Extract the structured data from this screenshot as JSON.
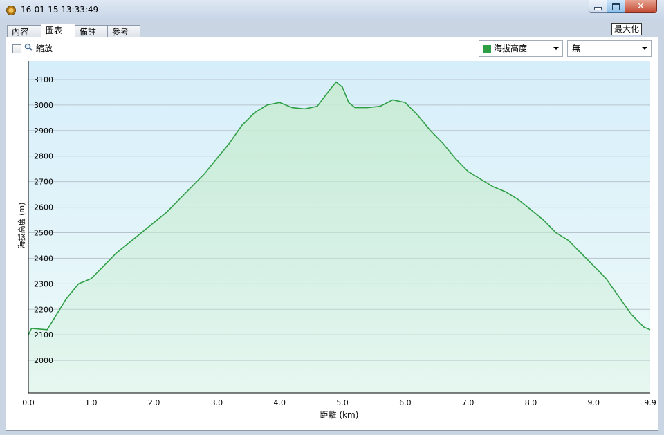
{
  "window": {
    "title": "16-01-15 13:33:49",
    "tooltip": "最大化"
  },
  "tabs": [
    "內容",
    "圖表",
    "備註",
    "參考"
  ],
  "active_tab": 1,
  "toolbar": {
    "zoom_label": "縮放",
    "zoom_checked": false,
    "series_select": "海拔高度",
    "compare_select": "無"
  },
  "colors": {
    "line": "#2e9e45",
    "plot_top": "#d6eefa",
    "plot_bottom": "#eefaf8",
    "fill": "#c8ecd2"
  },
  "chart_data": {
    "type": "area",
    "xlabel": "距離  (km)",
    "ylabel": "海拔高度 (m)",
    "x_ticks": [
      "0.0",
      "1.0",
      "2.0",
      "3.0",
      "4.0",
      "5.0",
      "6.0",
      "7.0",
      "8.0",
      "9.0",
      "9.9"
    ],
    "y_ticks": [
      "2000",
      "2100",
      "2200",
      "2300",
      "2400",
      "2500",
      "2600",
      "2700",
      "2800",
      "2900",
      "3000",
      "3100"
    ],
    "xlim": [
      0,
      9.9
    ],
    "ylim": [
      1873,
      3173
    ],
    "grid": true,
    "series": [
      {
        "x": [
          0.0,
          0.05,
          0.3,
          0.5,
          0.6,
          0.8,
          1.0,
          1.2,
          1.4,
          1.6,
          1.8,
          2.0,
          2.2,
          2.4,
          2.6,
          2.8,
          3.0,
          3.2,
          3.4,
          3.6,
          3.8,
          4.0,
          4.2,
          4.4,
          4.6,
          4.8,
          4.9,
          5.0,
          5.1,
          5.2,
          5.4,
          5.6,
          5.8,
          6.0,
          6.2,
          6.4,
          6.6,
          6.8,
          7.0,
          7.2,
          7.4,
          7.6,
          7.8,
          8.0,
          8.2,
          8.4,
          8.6,
          8.8,
          9.0,
          9.2,
          9.4,
          9.6,
          9.8,
          9.9
        ],
        "y": [
          2100,
          2125,
          2120,
          2200,
          2240,
          2300,
          2320,
          2370,
          2420,
          2460,
          2500,
          2540,
          2580,
          2630,
          2680,
          2730,
          2790,
          2850,
          2920,
          2970,
          3000,
          3010,
          2990,
          2985,
          2995,
          3060,
          3090,
          3070,
          3010,
          2990,
          2990,
          2995,
          3020,
          3010,
          2960,
          2900,
          2850,
          2790,
          2740,
          2710,
          2680,
          2660,
          2630,
          2590,
          2550,
          2500,
          2470,
          2420,
          2370,
          2320,
          2250,
          2180,
          2130,
          2120
        ]
      }
    ]
  }
}
